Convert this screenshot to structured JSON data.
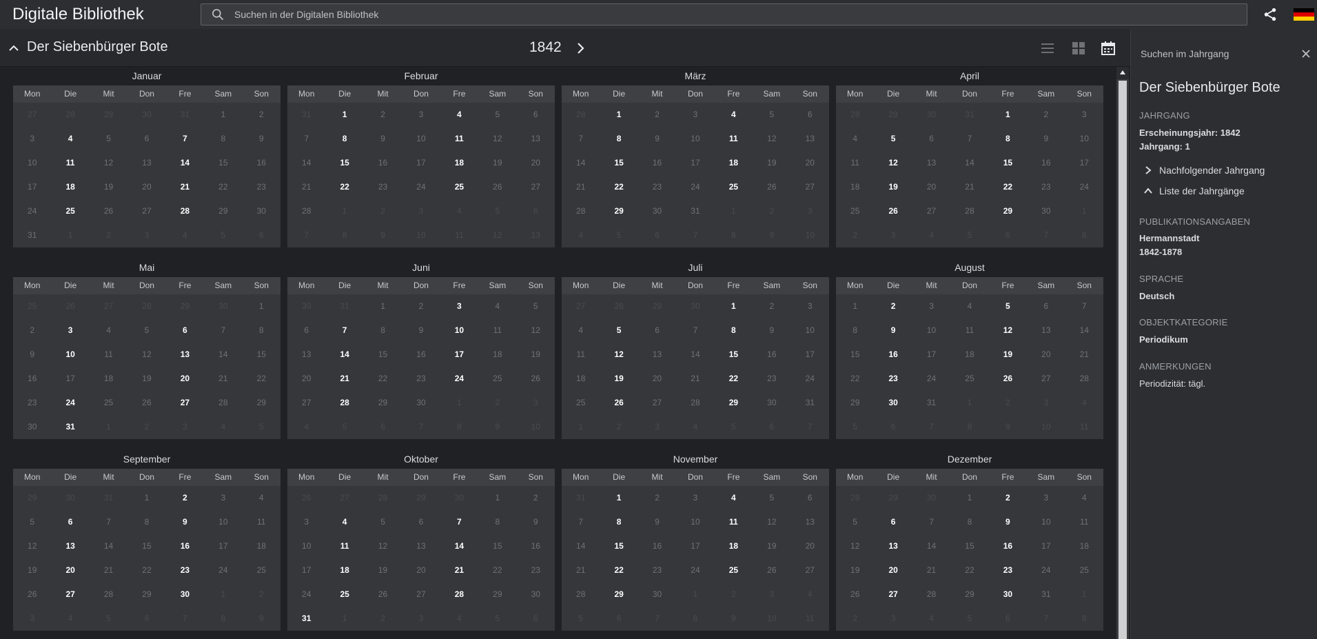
{
  "app": {
    "title": "Digitale Bibliothek"
  },
  "search": {
    "placeholder": "Suchen in der Digitalen Bibliothek"
  },
  "header": {
    "periodical": "Der Siebenbürger Bote",
    "year": "1842"
  },
  "weekdays": [
    "Mon",
    "Die",
    "Mit",
    "Don",
    "Fre",
    "Sam",
    "Son"
  ],
  "months": [
    {
      "name": "Januar",
      "weeks": [
        [
          "27",
          "28",
          "29",
          "30",
          "31",
          "1",
          "2"
        ],
        [
          "3",
          "4",
          "5",
          "6",
          "7",
          "8",
          "9"
        ],
        [
          "10",
          "11",
          "12",
          "13",
          "14",
          "15",
          "16"
        ],
        [
          "17",
          "18",
          "19",
          "20",
          "21",
          "22",
          "23"
        ],
        [
          "24",
          "25",
          "26",
          "27",
          "28",
          "29",
          "30"
        ],
        [
          "31",
          "1",
          "2",
          "3",
          "4",
          "5",
          "6"
        ]
      ],
      "lead": 5,
      "days": 31,
      "issues": [
        "4",
        "7",
        "11",
        "14",
        "18",
        "21",
        "25",
        "28"
      ]
    },
    {
      "name": "Februar",
      "weeks": [
        [
          "31",
          "1",
          "2",
          "3",
          "4",
          "5",
          "6"
        ],
        [
          "7",
          "8",
          "9",
          "10",
          "11",
          "12",
          "13"
        ],
        [
          "14",
          "15",
          "16",
          "17",
          "18",
          "19",
          "20"
        ],
        [
          "21",
          "22",
          "23",
          "24",
          "25",
          "26",
          "27"
        ],
        [
          "28",
          "1",
          "2",
          "3",
          "4",
          "5",
          "6"
        ],
        [
          "7",
          "8",
          "9",
          "10",
          "11",
          "12",
          "13"
        ]
      ],
      "lead": 1,
      "days": 28,
      "issues": [
        "1",
        "4",
        "8",
        "11",
        "15",
        "18",
        "22",
        "25"
      ]
    },
    {
      "name": "März",
      "weeks": [
        [
          "28",
          "1",
          "2",
          "3",
          "4",
          "5",
          "6"
        ],
        [
          "7",
          "8",
          "9",
          "10",
          "11",
          "12",
          "13"
        ],
        [
          "14",
          "15",
          "16",
          "17",
          "18",
          "19",
          "20"
        ],
        [
          "21",
          "22",
          "23",
          "24",
          "25",
          "26",
          "27"
        ],
        [
          "28",
          "29",
          "30",
          "31",
          "1",
          "2",
          "3"
        ],
        [
          "4",
          "5",
          "6",
          "7",
          "8",
          "9",
          "10"
        ]
      ],
      "lead": 1,
      "days": 31,
      "issues": [
        "1",
        "4",
        "8",
        "11",
        "15",
        "18",
        "22",
        "25",
        "29"
      ]
    },
    {
      "name": "April",
      "weeks": [
        [
          "28",
          "29",
          "30",
          "31",
          "1",
          "2",
          "3"
        ],
        [
          "4",
          "5",
          "6",
          "7",
          "8",
          "9",
          "10"
        ],
        [
          "11",
          "12",
          "13",
          "14",
          "15",
          "16",
          "17"
        ],
        [
          "18",
          "19",
          "20",
          "21",
          "22",
          "23",
          "24"
        ],
        [
          "25",
          "26",
          "27",
          "28",
          "29",
          "30",
          "1"
        ],
        [
          "2",
          "3",
          "4",
          "5",
          "6",
          "7",
          "8"
        ]
      ],
      "lead": 4,
      "days": 30,
      "issues": [
        "1",
        "5",
        "8",
        "12",
        "15",
        "19",
        "22",
        "26",
        "29"
      ]
    },
    {
      "name": "Mai",
      "weeks": [
        [
          "25",
          "26",
          "27",
          "28",
          "29",
          "30",
          "1"
        ],
        [
          "2",
          "3",
          "4",
          "5",
          "6",
          "7",
          "8"
        ],
        [
          "9",
          "10",
          "11",
          "12",
          "13",
          "14",
          "15"
        ],
        [
          "16",
          "17",
          "18",
          "19",
          "20",
          "21",
          "22"
        ],
        [
          "23",
          "24",
          "25",
          "26",
          "27",
          "28",
          "29"
        ],
        [
          "30",
          "31",
          "1",
          "2",
          "3",
          "4",
          "5"
        ]
      ],
      "lead": 6,
      "days": 31,
      "issues": [
        "3",
        "6",
        "10",
        "13",
        "20",
        "24",
        "27",
        "31"
      ]
    },
    {
      "name": "Juni",
      "weeks": [
        [
          "30",
          "31",
          "1",
          "2",
          "3",
          "4",
          "5"
        ],
        [
          "6",
          "7",
          "8",
          "9",
          "10",
          "11",
          "12"
        ],
        [
          "13",
          "14",
          "15",
          "16",
          "17",
          "18",
          "19"
        ],
        [
          "20",
          "21",
          "22",
          "23",
          "24",
          "25",
          "26"
        ],
        [
          "27",
          "28",
          "29",
          "30",
          "1",
          "2",
          "3"
        ],
        [
          "4",
          "5",
          "6",
          "7",
          "8",
          "9",
          "10"
        ]
      ],
      "lead": 2,
      "days": 30,
      "issues": [
        "3",
        "7",
        "10",
        "14",
        "17",
        "21",
        "24",
        "28"
      ]
    },
    {
      "name": "Juli",
      "weeks": [
        [
          "27",
          "28",
          "29",
          "30",
          "1",
          "2",
          "3"
        ],
        [
          "4",
          "5",
          "6",
          "7",
          "8",
          "9",
          "10"
        ],
        [
          "11",
          "12",
          "13",
          "14",
          "15",
          "16",
          "17"
        ],
        [
          "18",
          "19",
          "20",
          "21",
          "22",
          "23",
          "24"
        ],
        [
          "25",
          "26",
          "27",
          "28",
          "29",
          "30",
          "31"
        ],
        [
          "1",
          "2",
          "3",
          "4",
          "5",
          "6",
          "7"
        ]
      ],
      "lead": 4,
      "days": 31,
      "issues": [
        "1",
        "5",
        "8",
        "12",
        "15",
        "19",
        "22",
        "26",
        "29"
      ]
    },
    {
      "name": "August",
      "weeks": [
        [
          "1",
          "2",
          "3",
          "4",
          "5",
          "6",
          "7"
        ],
        [
          "8",
          "9",
          "10",
          "11",
          "12",
          "13",
          "14"
        ],
        [
          "15",
          "16",
          "17",
          "18",
          "19",
          "20",
          "21"
        ],
        [
          "22",
          "23",
          "24",
          "25",
          "26",
          "27",
          "28"
        ],
        [
          "29",
          "30",
          "31",
          "1",
          "2",
          "3",
          "4"
        ],
        [
          "5",
          "6",
          "7",
          "8",
          "9",
          "10",
          "11"
        ]
      ],
      "lead": 0,
      "days": 31,
      "issues": [
        "2",
        "5",
        "9",
        "12",
        "16",
        "19",
        "23",
        "26",
        "30"
      ]
    },
    {
      "name": "September",
      "weeks": [
        [
          "29",
          "30",
          "31",
          "1",
          "2",
          "3",
          "4"
        ],
        [
          "5",
          "6",
          "7",
          "8",
          "9",
          "10",
          "11"
        ],
        [
          "12",
          "13",
          "14",
          "15",
          "16",
          "17",
          "18"
        ],
        [
          "19",
          "20",
          "21",
          "22",
          "23",
          "24",
          "25"
        ],
        [
          "26",
          "27",
          "28",
          "29",
          "30",
          "1",
          "2"
        ],
        [
          "3",
          "4",
          "5",
          "6",
          "7",
          "8",
          "9"
        ]
      ],
      "lead": 3,
      "days": 30,
      "issues": [
        "2",
        "6",
        "9",
        "13",
        "16",
        "20",
        "23",
        "27",
        "30"
      ]
    },
    {
      "name": "Oktober",
      "weeks": [
        [
          "26",
          "27",
          "28",
          "29",
          "30",
          "1",
          "2"
        ],
        [
          "3",
          "4",
          "5",
          "6",
          "7",
          "8",
          "9"
        ],
        [
          "10",
          "11",
          "12",
          "13",
          "14",
          "15",
          "16"
        ],
        [
          "17",
          "18",
          "19",
          "20",
          "21",
          "22",
          "23"
        ],
        [
          "24",
          "25",
          "26",
          "27",
          "28",
          "29",
          "30"
        ],
        [
          "31",
          "1",
          "2",
          "3",
          "4",
          "5",
          "6"
        ]
      ],
      "lead": 5,
      "days": 31,
      "issues": [
        "4",
        "7",
        "11",
        "14",
        "18",
        "21",
        "25",
        "28",
        "31"
      ]
    },
    {
      "name": "November",
      "weeks": [
        [
          "31",
          "1",
          "2",
          "3",
          "4",
          "5",
          "6"
        ],
        [
          "7",
          "8",
          "9",
          "10",
          "11",
          "12",
          "13"
        ],
        [
          "14",
          "15",
          "16",
          "17",
          "18",
          "19",
          "20"
        ],
        [
          "21",
          "22",
          "23",
          "24",
          "25",
          "26",
          "27"
        ],
        [
          "28",
          "29",
          "30",
          "1",
          "2",
          "3",
          "4"
        ],
        [
          "5",
          "6",
          "7",
          "8",
          "9",
          "10",
          "11"
        ]
      ],
      "lead": 1,
      "days": 30,
      "issues": [
        "1",
        "4",
        "8",
        "11",
        "15",
        "18",
        "22",
        "25",
        "29"
      ]
    },
    {
      "name": "Dezember",
      "weeks": [
        [
          "28",
          "29",
          "30",
          "1",
          "2",
          "3",
          "4"
        ],
        [
          "5",
          "6",
          "7",
          "8",
          "9",
          "10",
          "11"
        ],
        [
          "12",
          "13",
          "14",
          "15",
          "16",
          "17",
          "18"
        ],
        [
          "19",
          "20",
          "21",
          "22",
          "23",
          "24",
          "25"
        ],
        [
          "26",
          "27",
          "28",
          "29",
          "30",
          "31",
          "1"
        ],
        [
          "2",
          "3",
          "4",
          "5",
          "6",
          "7",
          "8"
        ]
      ],
      "lead": 3,
      "days": 31,
      "issues": [
        "2",
        "6",
        "9",
        "13",
        "16",
        "20",
        "23",
        "27",
        "30"
      ]
    }
  ],
  "side": {
    "search_label": "Suchen im Jahrgang",
    "title": "Der Siebenbürger Bote",
    "jahrgang_head": "JAHRGANG",
    "erscheinungsjahr": "Erscheinungsjahr: 1842",
    "jahrgang": "Jahrgang: 1",
    "next_link": "Nachfolgender Jahrgang",
    "list_link": "Liste der Jahrgänge",
    "pub_head": "PUBLIKATIONSANGABEN",
    "pub_place": "Hermannstadt",
    "pub_years": "1842-1878",
    "lang_head": "SPRACHE",
    "lang": "Deutsch",
    "cat_head": "OBJEKTKATEGORIE",
    "cat": "Periodikum",
    "notes_head": "ANMERKUNGEN",
    "notes": "Periodizität: tägl."
  },
  "colors": {
    "issue": "#ffffff",
    "day": "#6f7175",
    "outside": "#4a4b4f",
    "flag": [
      "#000000",
      "#dd0000",
      "#ffce00"
    ]
  }
}
